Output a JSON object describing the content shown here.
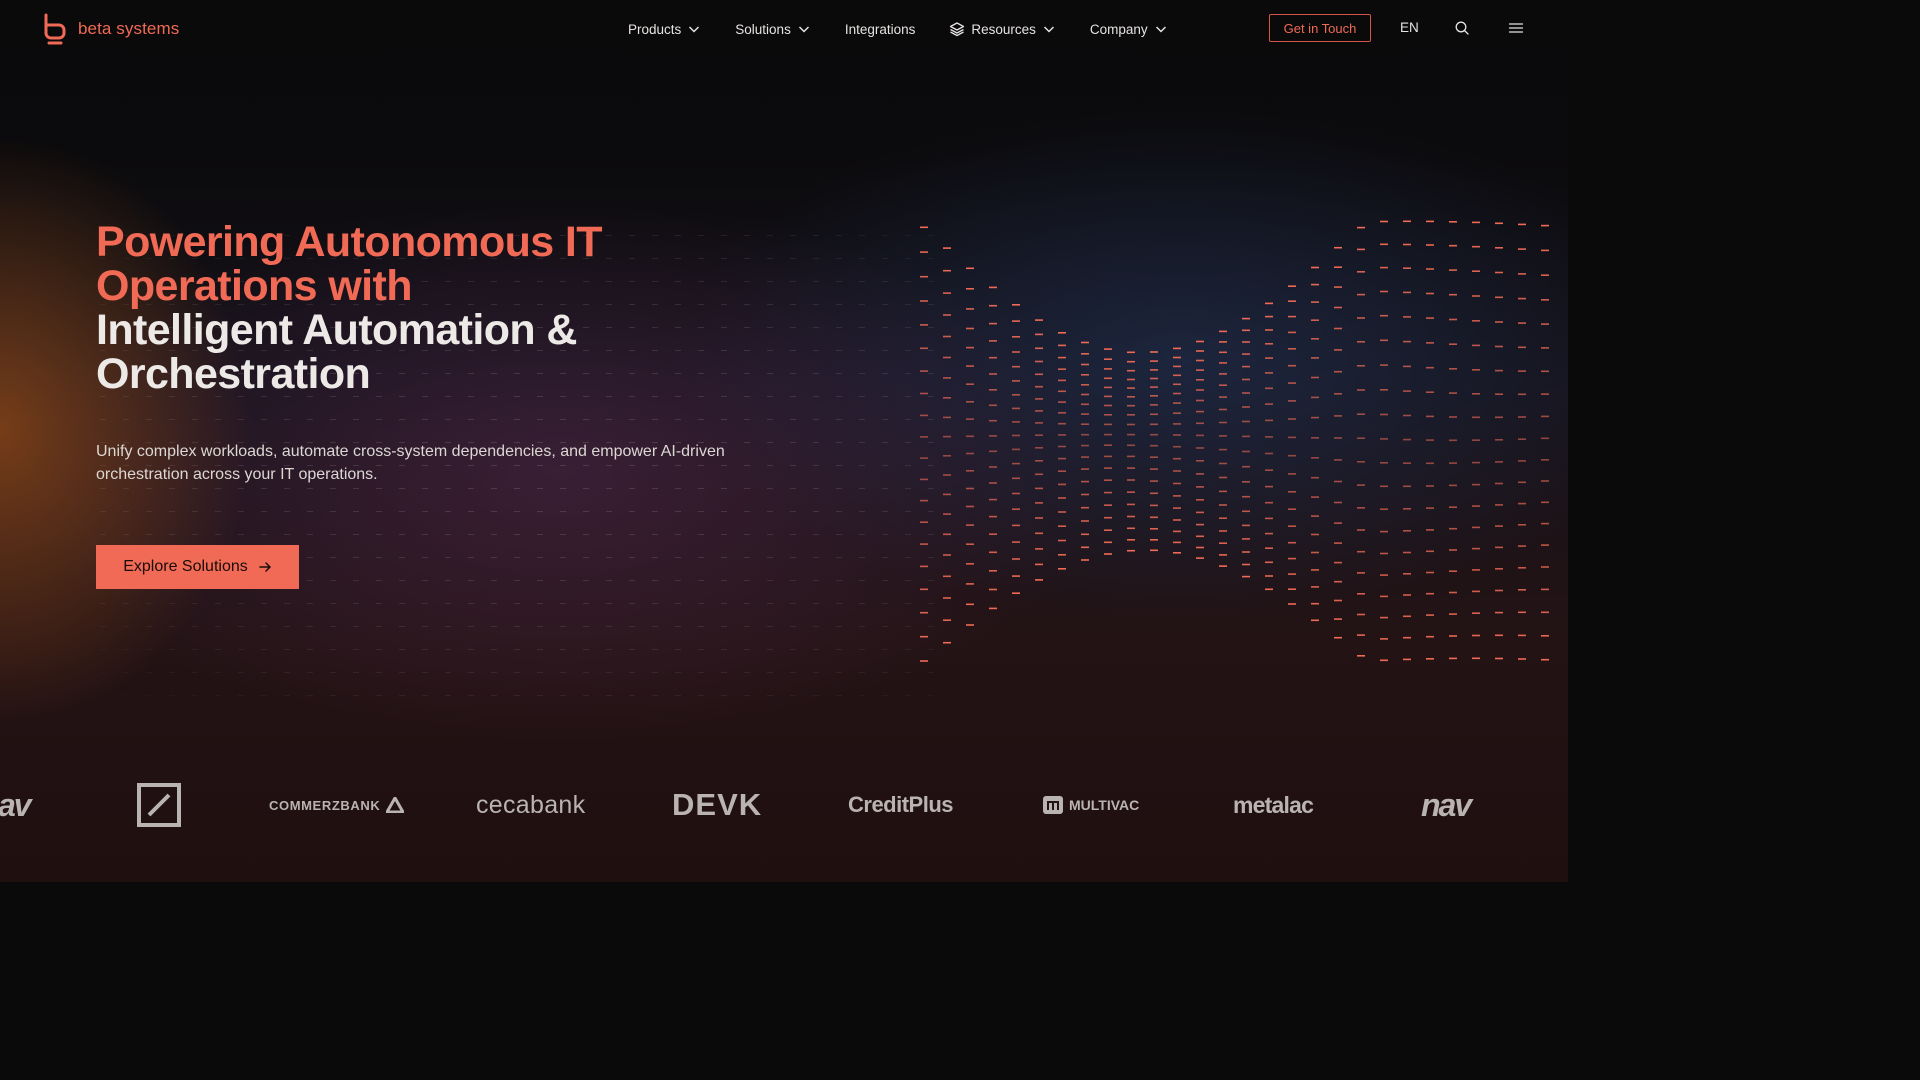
{
  "brand": {
    "name": "beta systems",
    "accent": "#f06a55"
  },
  "header": {
    "nav": [
      {
        "label": "Products",
        "dropdown": true,
        "icon": ""
      },
      {
        "label": "Solutions",
        "dropdown": true,
        "icon": ""
      },
      {
        "label": "Integrations",
        "dropdown": false,
        "icon": ""
      },
      {
        "label": "Resources",
        "dropdown": true,
        "icon": "layers-icon"
      },
      {
        "label": "Company",
        "dropdown": true,
        "icon": ""
      }
    ],
    "cta_label": "Get in Touch",
    "language": "EN",
    "icons": {
      "search": "search-icon",
      "menu": "menu-icon"
    }
  },
  "hero": {
    "title_accent_line1": "Powering Autonomous IT",
    "title_accent_line2": "Operations with",
    "title_line3": "Intelligent Automation &",
    "title_line4": "Orchestration",
    "subtitle": "Unify complex workloads, automate cross-system dependencies, and empower AI-driven orchestration across your IT operations.",
    "cta_label": "Explore Solutions",
    "cta_icon": "arrow-right-icon"
  },
  "client_logos": [
    {
      "name": "nav-partial",
      "text": "av"
    },
    {
      "name": "deutsche-bank",
      "text": ""
    },
    {
      "name": "commerzbank",
      "text": "COMMERZBANK"
    },
    {
      "name": "cecabank",
      "text": "cecabank"
    },
    {
      "name": "devk",
      "text": "DEVK"
    },
    {
      "name": "creditplus",
      "text": "CreditPlus"
    },
    {
      "name": "multivac",
      "text": "MULTIVAC"
    },
    {
      "name": "metalac",
      "text": "metalac"
    },
    {
      "name": "nav",
      "text": "nav"
    }
  ]
}
